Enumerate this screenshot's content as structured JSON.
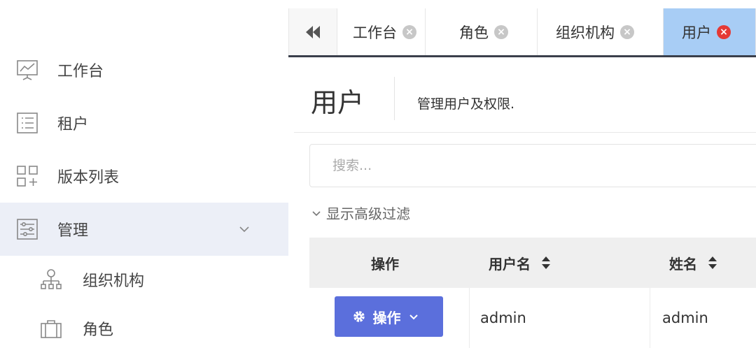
{
  "sidebar": {
    "items": [
      {
        "label": "工作台",
        "icon": "presentation-chart-icon"
      },
      {
        "label": "租户",
        "icon": "list-icon"
      },
      {
        "label": "版本列表",
        "icon": "grid-plus-icon"
      },
      {
        "label": "管理",
        "icon": "sliders-icon",
        "expanded": true
      },
      {
        "label": "组织机构",
        "icon": "org-chart-icon"
      },
      {
        "label": "角色",
        "icon": "briefcase-icon"
      }
    ]
  },
  "tabs": {
    "items": [
      {
        "label": "工作台"
      },
      {
        "label": "角色"
      },
      {
        "label": "组织机构"
      },
      {
        "label": "用户",
        "active": true
      }
    ],
    "close_glyph": "×"
  },
  "header": {
    "title": "用户",
    "description": "管理用户及权限."
  },
  "search": {
    "placeholder": "搜索..."
  },
  "advanced_filter": {
    "label": "显示高级过滤"
  },
  "table": {
    "columns": [
      "操作",
      "用户名",
      "姓名"
    ],
    "rows": [
      {
        "action_label": "操作",
        "username": "admin",
        "name": "admin"
      }
    ]
  },
  "colors": {
    "active_tab": "#a8cdf5",
    "close_active": "#e53935",
    "action_button": "#5b6fdc",
    "sidebar_active": "#eceff7"
  }
}
